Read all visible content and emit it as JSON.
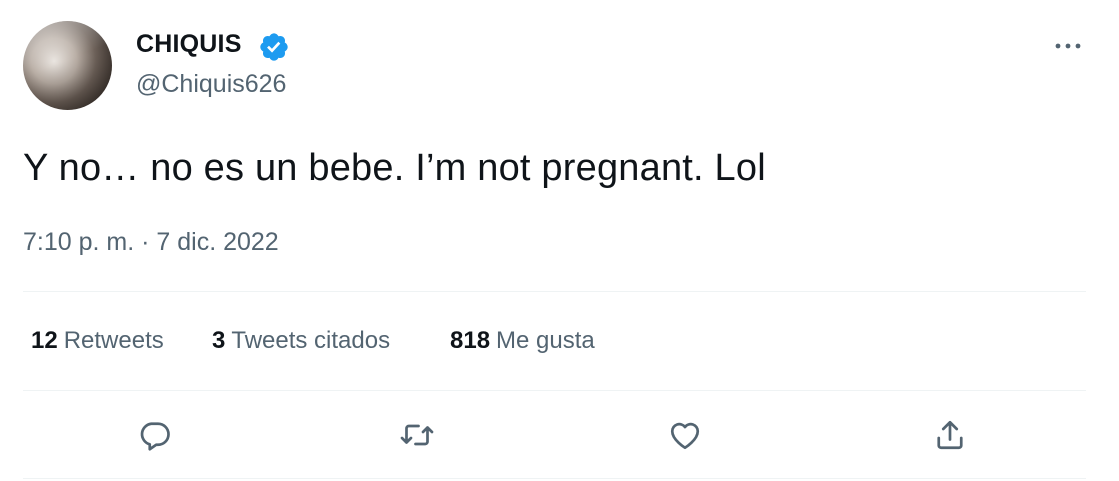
{
  "author": {
    "display_name": "CHIQUIS",
    "handle": "@Chiquis626",
    "verified": true,
    "verified_color": "#1d9bf0"
  },
  "tweet": {
    "text": "Y no… no es un bebe. I’m not pregnant. Lol",
    "timestamp": "7:10 p. m. · 7 dic. 2022"
  },
  "stats": {
    "retweets_count": "12",
    "retweets_label": "Retweets",
    "quotes_count": "3",
    "quotes_label": "Tweets citados",
    "likes_count": "818",
    "likes_label": "Me gusta"
  },
  "actions": {
    "icons": [
      "reply-icon",
      "retweet-icon",
      "like-icon",
      "share-icon"
    ]
  },
  "colors": {
    "text_primary": "#0f1419",
    "text_secondary": "#536471",
    "divider": "#eff3f4"
  }
}
